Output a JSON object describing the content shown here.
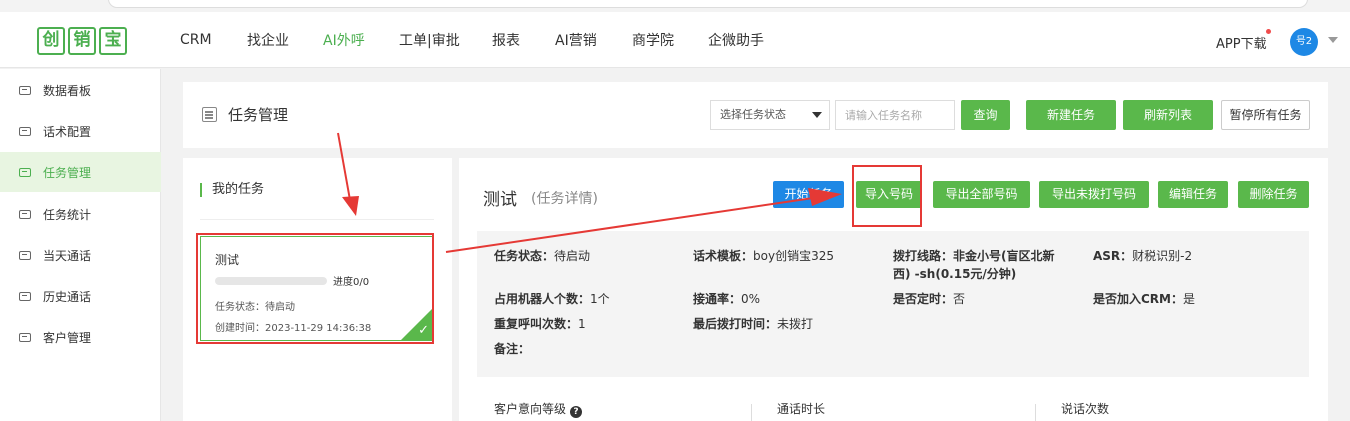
{
  "brand": {
    "logo_chars": [
      "创",
      "销",
      "宝"
    ]
  },
  "topnav": {
    "items": [
      {
        "label": "CRM",
        "active": false
      },
      {
        "label": "找企业",
        "active": false
      },
      {
        "label": "AI外呼",
        "active": true
      },
      {
        "label": "工单|审批",
        "active": false
      },
      {
        "label": "报表",
        "active": false
      },
      {
        "label": "AI营销",
        "active": false
      },
      {
        "label": "商学院",
        "active": false
      },
      {
        "label": "企微助手",
        "active": false
      }
    ],
    "app_download": "APP下载",
    "avatar_text": "号2"
  },
  "sidebar": {
    "items": [
      {
        "label": "数据看板",
        "icon": "chat-icon"
      },
      {
        "label": "话术配置",
        "icon": "chat-icon"
      },
      {
        "label": "任务管理",
        "icon": "chat-icon",
        "active": true
      },
      {
        "label": "任务统计",
        "icon": "chat-icon"
      },
      {
        "label": "当天通话",
        "icon": "chat-icon"
      },
      {
        "label": "历史通话",
        "icon": "chat-icon"
      },
      {
        "label": "客户管理",
        "icon": "chat-icon"
      }
    ]
  },
  "header": {
    "title": "任务管理",
    "status_select": "选择任务状态",
    "name_placeholder": "请输入任务名称",
    "query_btn": "查询",
    "new_task_btn": "新建任务",
    "refresh_btn": "刷新列表",
    "pause_all_btn": "暂停所有任务"
  },
  "my_tasks": {
    "title": "我的任务",
    "card": {
      "name": "测试",
      "progress": 0,
      "progress_text": "进度0/0",
      "status": "任务状态：待启动",
      "created": "创建时间：2023-11-29 14:36:38"
    }
  },
  "detail": {
    "title": "测试",
    "subtitle": "(任务详情)",
    "buttons": {
      "start": "开始任务",
      "import": "导入号码",
      "export_all": "导出全部号码",
      "export_undialed": "导出未拨打号码",
      "edit": "编辑任务",
      "delete": "删除任务"
    },
    "info": {
      "status_label": "任务状态：",
      "status_value": "待启动",
      "script_label": "话术模板：",
      "script_value": "boy创销宝325",
      "line_label": "拨打线路：",
      "line_value": "非金小号(盲区北新",
      "line_value_2": "西) -sh(0.15元/分钟)",
      "asr_label": "ASR：",
      "asr_value": "财税识别-2",
      "robots_label": "占用机器人个数：",
      "robots_value": "1个",
      "connect_label": "接通率：",
      "connect_value": "0%",
      "scheduled_label": "是否定时：",
      "scheduled_value": "否",
      "crm_label": "是否加入CRM：",
      "crm_value": "是",
      "repeat_label": "重复呼叫次数：",
      "repeat_value": "1",
      "last_dial_label": "最后拨打时间：",
      "last_dial_value": "未拨打",
      "note_label": "备注："
    },
    "stats": {
      "intent": "客户意向等级",
      "duration": "通话时长",
      "talk_count": "说话次数"
    }
  },
  "colors": {
    "green": "#5ab84b",
    "blue": "#1e88e5",
    "annotation": "#e53935"
  }
}
